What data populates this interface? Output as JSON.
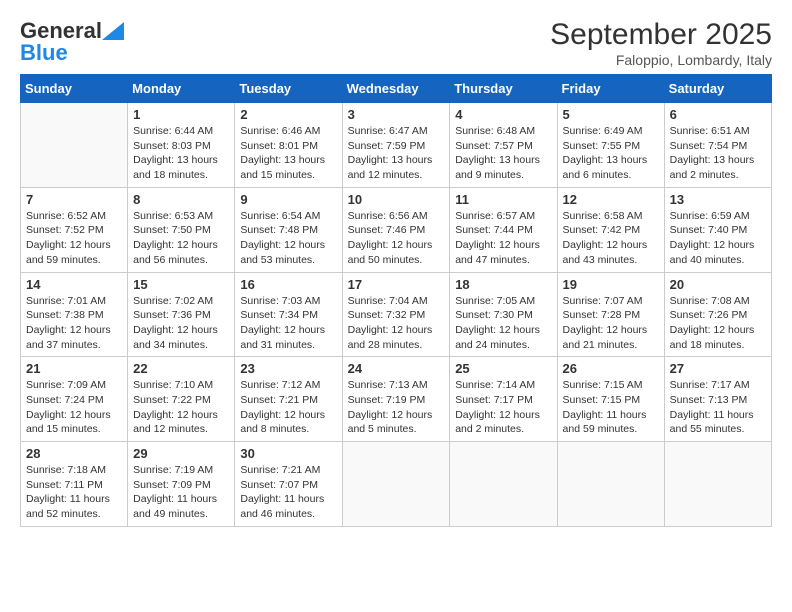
{
  "logo": {
    "line1": "General",
    "line2": "Blue"
  },
  "title": "September 2025",
  "subtitle": "Faloppio, Lombardy, Italy",
  "days_of_week": [
    "Sunday",
    "Monday",
    "Tuesday",
    "Wednesday",
    "Thursday",
    "Friday",
    "Saturday"
  ],
  "weeks": [
    [
      {
        "day": "",
        "sunrise": "",
        "sunset": "",
        "daylight": ""
      },
      {
        "day": "1",
        "sunrise": "Sunrise: 6:44 AM",
        "sunset": "Sunset: 8:03 PM",
        "daylight": "Daylight: 13 hours and 18 minutes."
      },
      {
        "day": "2",
        "sunrise": "Sunrise: 6:46 AM",
        "sunset": "Sunset: 8:01 PM",
        "daylight": "Daylight: 13 hours and 15 minutes."
      },
      {
        "day": "3",
        "sunrise": "Sunrise: 6:47 AM",
        "sunset": "Sunset: 7:59 PM",
        "daylight": "Daylight: 13 hours and 12 minutes."
      },
      {
        "day": "4",
        "sunrise": "Sunrise: 6:48 AM",
        "sunset": "Sunset: 7:57 PM",
        "daylight": "Daylight: 13 hours and 9 minutes."
      },
      {
        "day": "5",
        "sunrise": "Sunrise: 6:49 AM",
        "sunset": "Sunset: 7:55 PM",
        "daylight": "Daylight: 13 hours and 6 minutes."
      },
      {
        "day": "6",
        "sunrise": "Sunrise: 6:51 AM",
        "sunset": "Sunset: 7:54 PM",
        "daylight": "Daylight: 13 hours and 2 minutes."
      }
    ],
    [
      {
        "day": "7",
        "sunrise": "Sunrise: 6:52 AM",
        "sunset": "Sunset: 7:52 PM",
        "daylight": "Daylight: 12 hours and 59 minutes."
      },
      {
        "day": "8",
        "sunrise": "Sunrise: 6:53 AM",
        "sunset": "Sunset: 7:50 PM",
        "daylight": "Daylight: 12 hours and 56 minutes."
      },
      {
        "day": "9",
        "sunrise": "Sunrise: 6:54 AM",
        "sunset": "Sunset: 7:48 PM",
        "daylight": "Daylight: 12 hours and 53 minutes."
      },
      {
        "day": "10",
        "sunrise": "Sunrise: 6:56 AM",
        "sunset": "Sunset: 7:46 PM",
        "daylight": "Daylight: 12 hours and 50 minutes."
      },
      {
        "day": "11",
        "sunrise": "Sunrise: 6:57 AM",
        "sunset": "Sunset: 7:44 PM",
        "daylight": "Daylight: 12 hours and 47 minutes."
      },
      {
        "day": "12",
        "sunrise": "Sunrise: 6:58 AM",
        "sunset": "Sunset: 7:42 PM",
        "daylight": "Daylight: 12 hours and 43 minutes."
      },
      {
        "day": "13",
        "sunrise": "Sunrise: 6:59 AM",
        "sunset": "Sunset: 7:40 PM",
        "daylight": "Daylight: 12 hours and 40 minutes."
      }
    ],
    [
      {
        "day": "14",
        "sunrise": "Sunrise: 7:01 AM",
        "sunset": "Sunset: 7:38 PM",
        "daylight": "Daylight: 12 hours and 37 minutes."
      },
      {
        "day": "15",
        "sunrise": "Sunrise: 7:02 AM",
        "sunset": "Sunset: 7:36 PM",
        "daylight": "Daylight: 12 hours and 34 minutes."
      },
      {
        "day": "16",
        "sunrise": "Sunrise: 7:03 AM",
        "sunset": "Sunset: 7:34 PM",
        "daylight": "Daylight: 12 hours and 31 minutes."
      },
      {
        "day": "17",
        "sunrise": "Sunrise: 7:04 AM",
        "sunset": "Sunset: 7:32 PM",
        "daylight": "Daylight: 12 hours and 28 minutes."
      },
      {
        "day": "18",
        "sunrise": "Sunrise: 7:05 AM",
        "sunset": "Sunset: 7:30 PM",
        "daylight": "Daylight: 12 hours and 24 minutes."
      },
      {
        "day": "19",
        "sunrise": "Sunrise: 7:07 AM",
        "sunset": "Sunset: 7:28 PM",
        "daylight": "Daylight: 12 hours and 21 minutes."
      },
      {
        "day": "20",
        "sunrise": "Sunrise: 7:08 AM",
        "sunset": "Sunset: 7:26 PM",
        "daylight": "Daylight: 12 hours and 18 minutes."
      }
    ],
    [
      {
        "day": "21",
        "sunrise": "Sunrise: 7:09 AM",
        "sunset": "Sunset: 7:24 PM",
        "daylight": "Daylight: 12 hours and 15 minutes."
      },
      {
        "day": "22",
        "sunrise": "Sunrise: 7:10 AM",
        "sunset": "Sunset: 7:22 PM",
        "daylight": "Daylight: 12 hours and 12 minutes."
      },
      {
        "day": "23",
        "sunrise": "Sunrise: 7:12 AM",
        "sunset": "Sunset: 7:21 PM",
        "daylight": "Daylight: 12 hours and 8 minutes."
      },
      {
        "day": "24",
        "sunrise": "Sunrise: 7:13 AM",
        "sunset": "Sunset: 7:19 PM",
        "daylight": "Daylight: 12 hours and 5 minutes."
      },
      {
        "day": "25",
        "sunrise": "Sunrise: 7:14 AM",
        "sunset": "Sunset: 7:17 PM",
        "daylight": "Daylight: 12 hours and 2 minutes."
      },
      {
        "day": "26",
        "sunrise": "Sunrise: 7:15 AM",
        "sunset": "Sunset: 7:15 PM",
        "daylight": "Daylight: 11 hours and 59 minutes."
      },
      {
        "day": "27",
        "sunrise": "Sunrise: 7:17 AM",
        "sunset": "Sunset: 7:13 PM",
        "daylight": "Daylight: 11 hours and 55 minutes."
      }
    ],
    [
      {
        "day": "28",
        "sunrise": "Sunrise: 7:18 AM",
        "sunset": "Sunset: 7:11 PM",
        "daylight": "Daylight: 11 hours and 52 minutes."
      },
      {
        "day": "29",
        "sunrise": "Sunrise: 7:19 AM",
        "sunset": "Sunset: 7:09 PM",
        "daylight": "Daylight: 11 hours and 49 minutes."
      },
      {
        "day": "30",
        "sunrise": "Sunrise: 7:21 AM",
        "sunset": "Sunset: 7:07 PM",
        "daylight": "Daylight: 11 hours and 46 minutes."
      },
      {
        "day": "",
        "sunrise": "",
        "sunset": "",
        "daylight": ""
      },
      {
        "day": "",
        "sunrise": "",
        "sunset": "",
        "daylight": ""
      },
      {
        "day": "",
        "sunrise": "",
        "sunset": "",
        "daylight": ""
      },
      {
        "day": "",
        "sunrise": "",
        "sunset": "",
        "daylight": ""
      }
    ]
  ]
}
